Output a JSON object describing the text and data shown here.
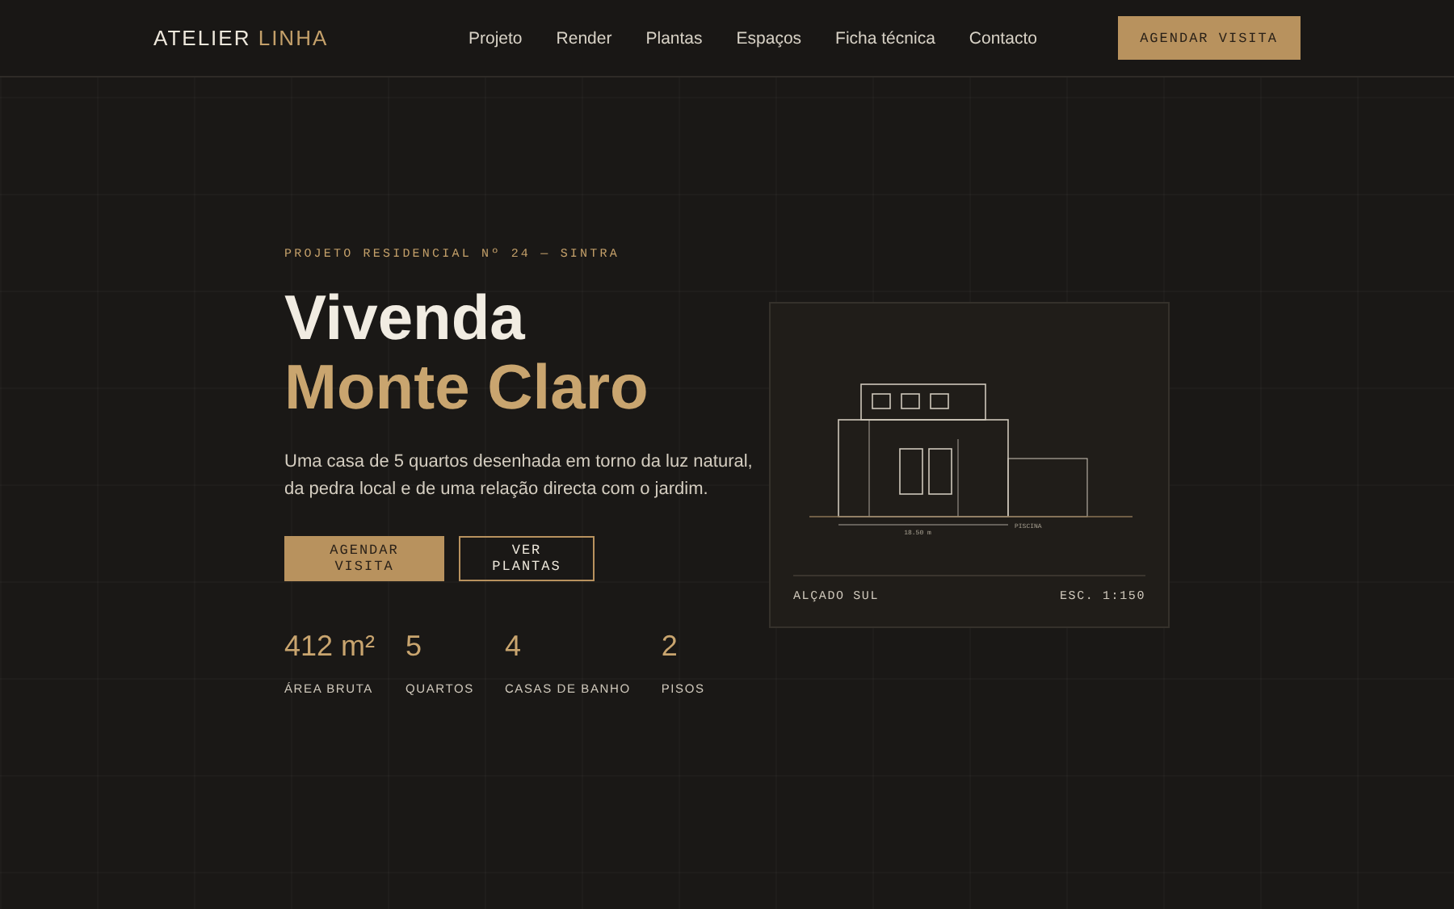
{
  "header": {
    "logo": {
      "first": "ATELIER",
      "second": "LINHA"
    },
    "nav": [
      {
        "label": "Projeto"
      },
      {
        "label": "Render"
      },
      {
        "label": "Plantas"
      },
      {
        "label": "Espaços"
      },
      {
        "label": "Ficha técnica"
      },
      {
        "label": "Contacto"
      }
    ],
    "cta": "AGENDAR VISITA"
  },
  "hero": {
    "eyebrow": "PROJETO RESIDENCIAL Nº 24 — SINTRA",
    "title_line1": "Vivenda",
    "title_line2": "Monte Claro",
    "description": "Uma casa de 5 quartos desenhada em torno da luz natural, da pedra local e de uma relação directa com o jardim.",
    "buttons": [
      {
        "label": "AGENDAR VISITA",
        "kind": "primary"
      },
      {
        "label": "VER PLANTAS",
        "kind": "outline"
      }
    ],
    "stats": [
      {
        "value": "412 m²",
        "label": "ÁREA BRUTA"
      },
      {
        "value": "5",
        "label": "QUARTOS"
      },
      {
        "value": "4",
        "label": "CASAS DE BANHO"
      },
      {
        "value": "2",
        "label": "PISOS"
      }
    ]
  },
  "drawing_card": {
    "dimension": "18.50 m",
    "annex_label": "PISCINA",
    "caption": "ALÇADO SUL",
    "scale": "ESC. 1:150"
  }
}
